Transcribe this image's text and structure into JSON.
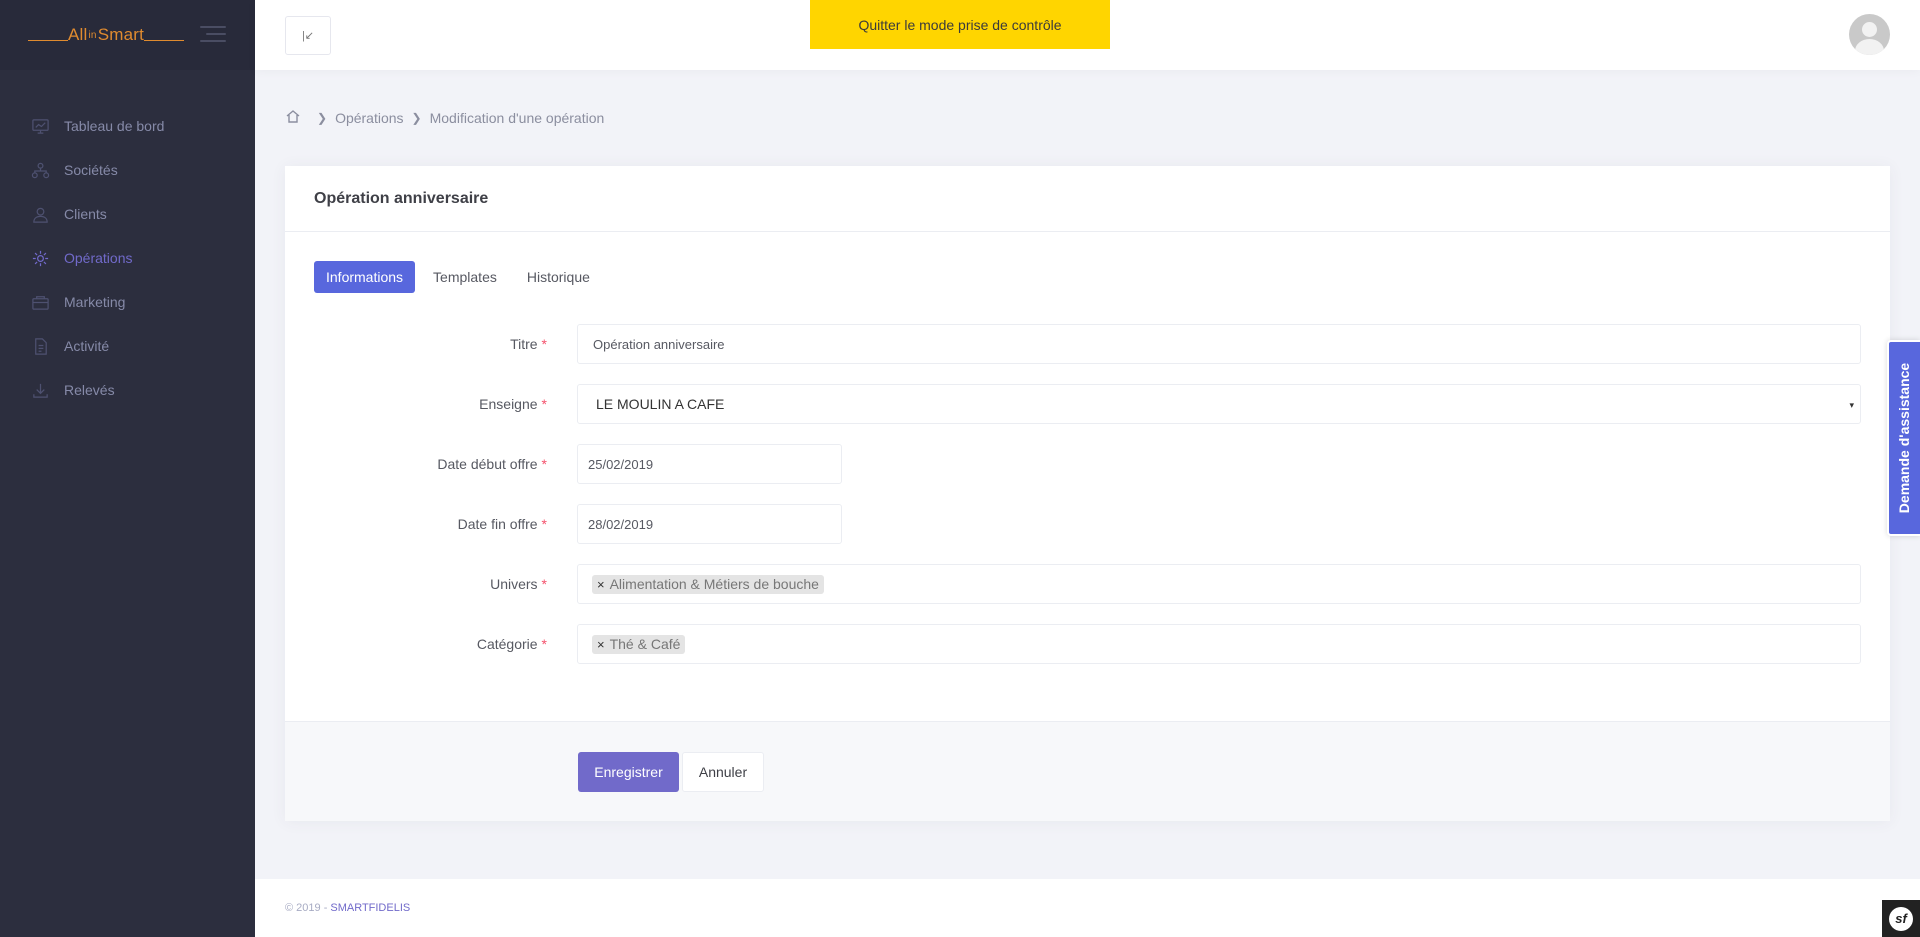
{
  "brand": {
    "name_left": "All",
    "name_in": "in",
    "name_right": "Smart"
  },
  "sidebar": {
    "items": [
      {
        "label": "Tableau de bord",
        "icon": "dashboard-icon",
        "active": false
      },
      {
        "label": "Sociétés",
        "icon": "org-chart-icon",
        "active": false
      },
      {
        "label": "Clients",
        "icon": "users-icon",
        "active": false
      },
      {
        "label": "Opérations",
        "icon": "operations-icon",
        "active": true
      },
      {
        "label": "Marketing",
        "icon": "marketing-icon",
        "active": false
      },
      {
        "label": "Activité",
        "icon": "activity-icon",
        "active": false
      },
      {
        "label": "Relevés",
        "icon": "download-icon",
        "active": false
      }
    ]
  },
  "header": {
    "takeover_label": "Quitter le mode prise de contrôle",
    "left_button_glyph": "|↙"
  },
  "breadcrumb": {
    "items": [
      "Opérations",
      "Modification d'une opération"
    ]
  },
  "card": {
    "title": "Opération anniversaire",
    "tabs": [
      "Informations",
      "Templates",
      "Historique"
    ],
    "active_tab": "Informations"
  },
  "form": {
    "titre": {
      "label": "Titre",
      "value": "Opération anniversaire"
    },
    "enseigne": {
      "label": "Enseigne",
      "value": "LE MOULIN A CAFE"
    },
    "date_debut": {
      "label": "Date début offre",
      "value": "25/02/2019"
    },
    "date_fin": {
      "label": "Date fin offre",
      "value": "28/02/2019"
    },
    "univers": {
      "label": "Univers",
      "tags": [
        "Alimentation & Métiers de bouche"
      ]
    },
    "categorie": {
      "label": "Catégorie",
      "tags": [
        "Thé & Café"
      ]
    },
    "required_mark": "*",
    "tag_remove": "×",
    "select_caret": "▾"
  },
  "actions": {
    "save": "Enregistrer",
    "cancel": "Annuler"
  },
  "assistance": {
    "label": "Demande d'assistance"
  },
  "footer": {
    "copyright": "© 2019 -",
    "company": "SMARTFIDELIS"
  },
  "symfony_badge": "sf",
  "colors": {
    "accent": "#716aca",
    "tab_active": "#5867dd",
    "takeover": "#ffd500",
    "sidebar_bg": "#2c2e3e",
    "required": "#f4516c"
  }
}
